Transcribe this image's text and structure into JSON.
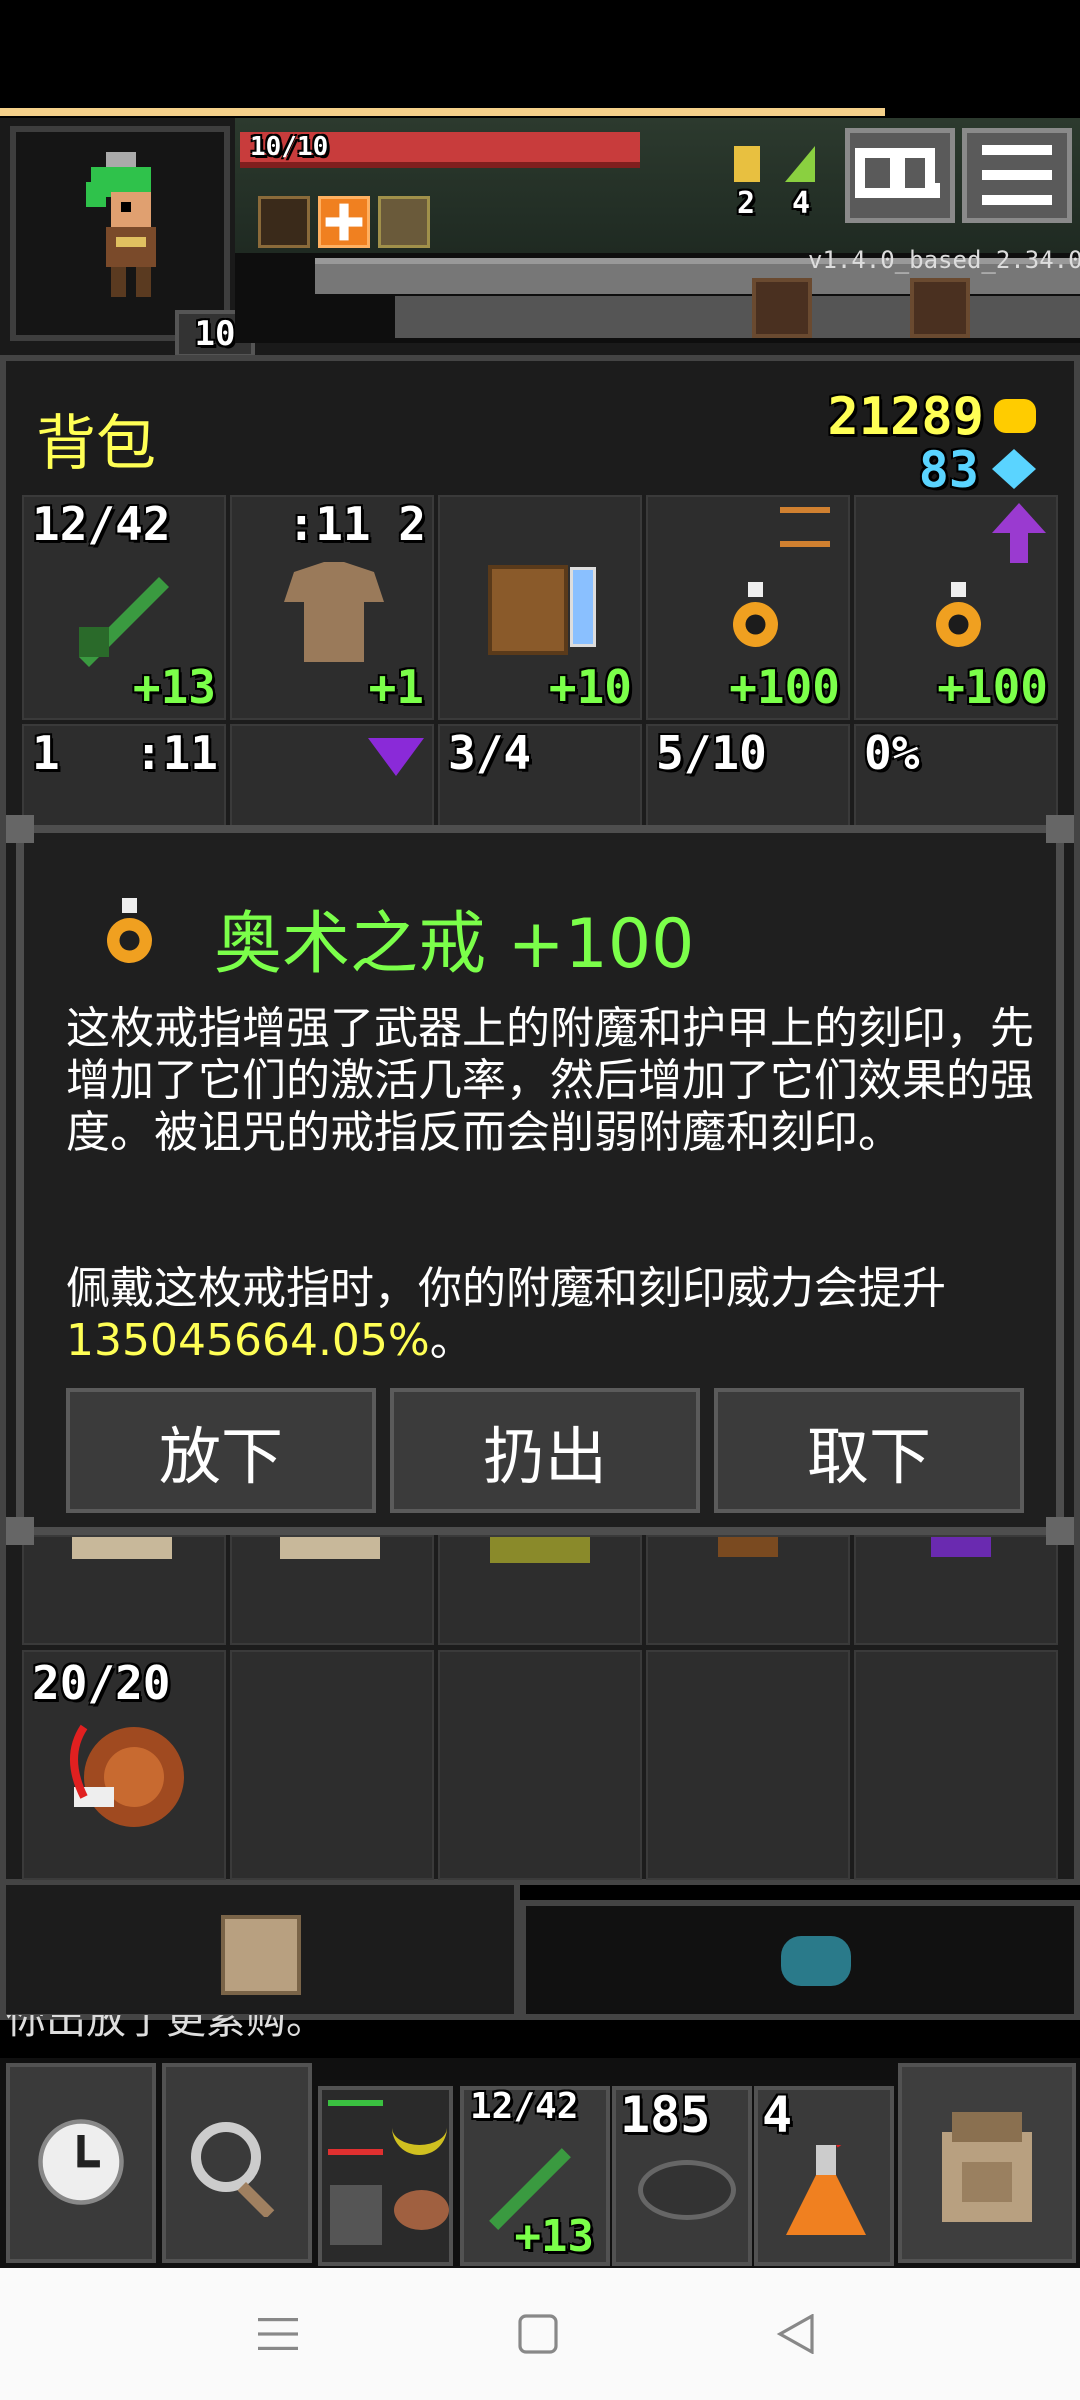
{
  "status": {
    "hp": "10/10",
    "depth": "10",
    "keys": [
      {
        "value": "2"
      },
      {
        "value": "4"
      }
    ],
    "version": "v1.4.0_based_2.34.0"
  },
  "inventory": {
    "title": "背包",
    "gold": "21289",
    "energy": "83",
    "row1": [
      {
        "tl": "12/42",
        "tr": "",
        "br": "+13"
      },
      {
        "tl": "",
        "tr": ":11 2",
        "br": "+1"
      },
      {
        "tl": "",
        "tr": "",
        "br": "+10"
      },
      {
        "tl": "",
        "tr": "",
        "br": "+100"
      },
      {
        "tl": "",
        "tr": "",
        "br": "+100"
      }
    ],
    "row2": [
      {
        "tl": "1",
        "tr": ":11"
      },
      {
        "tl": "",
        "tr": ""
      },
      {
        "tl": "3/4",
        "tr": ""
      },
      {
        "tl": "5/10",
        "tr": ""
      },
      {
        "tl": "0%",
        "tr": ""
      }
    ],
    "row4_first": "20/20"
  },
  "dialog": {
    "title": "奥术之戒 +100",
    "description": "这枚戒指增强了武器上的附魔和护甲上的刻印，先增加了它们的激活几率，然后增加了它们效果的强度。被诅咒的戒指反而会削弱附魔和刻印。",
    "effect_prefix": "佩戴这枚戒指时，你的附魔和刻印威力会提升 ",
    "effect_value": "135045664.05%",
    "effect_suffix": "。",
    "buttons": [
      "放下",
      "扔出",
      "取下"
    ]
  },
  "log_text": "你出放了更累购。",
  "toolbar": {
    "quickslot1": {
      "top": "12/42",
      "bottom": "+13"
    },
    "quickslot2": {
      "top": "185"
    },
    "quickslot3": {
      "top": "4"
    }
  },
  "colors": {
    "accent_green": "#7bff4a",
    "gold": "#ffff55",
    "energy": "#5ad4ff",
    "hp_bar": "#c83c3c"
  }
}
